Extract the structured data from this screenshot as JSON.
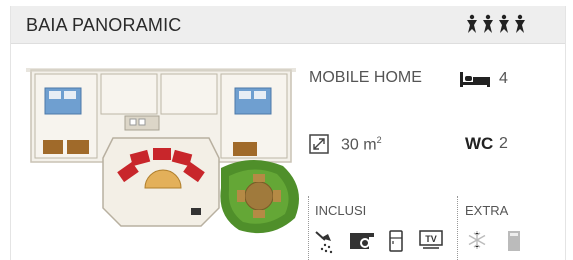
{
  "header": {
    "title": "BAIA PANORAMIC",
    "stars": 4
  },
  "floorplan": {
    "icon": "floorplan-image"
  },
  "specs": {
    "type_label": "MOBILE HOME",
    "beds_icon": "bed-icon",
    "beds": "4",
    "area_icon": "resize-icon",
    "area_value": "30 m",
    "area_sup": "2",
    "wc_label": "WC",
    "wc_count": "2"
  },
  "included": {
    "label": "INCLUSI",
    "icons": [
      "shower-icon",
      "coffee-machine-icon",
      "fridge-icon",
      "tv-icon"
    ]
  },
  "extra": {
    "label": "EXTRA",
    "icons": [
      "air-conditioning-icon",
      "dishwasher-icon"
    ]
  },
  "colors": {
    "header_bg": "#eeeeee",
    "sofa_red": "#c8262b",
    "grass": "#4f8f2a"
  }
}
